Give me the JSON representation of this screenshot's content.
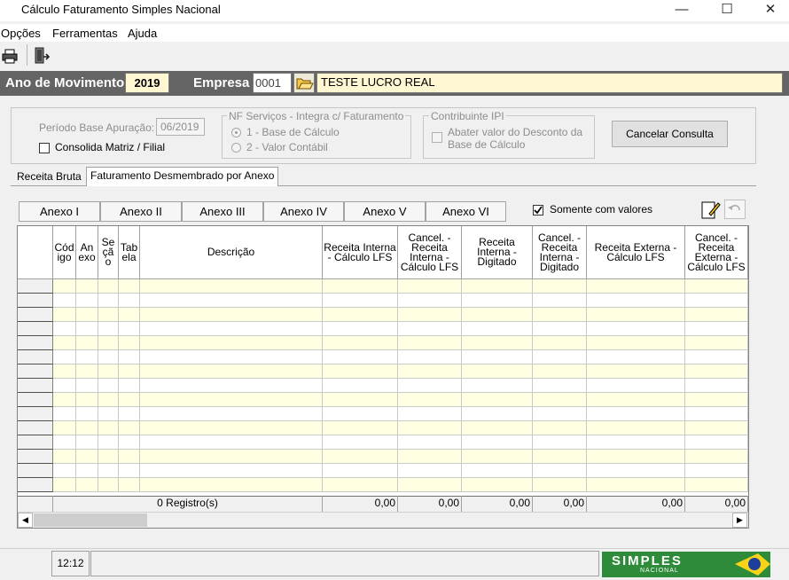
{
  "window": {
    "title": "Cálculo Faturamento Simples Nacional"
  },
  "menu": {
    "items": [
      "Opções",
      "Ferramentas",
      "Ajuda"
    ]
  },
  "header": {
    "ano_label": "Ano de Movimento",
    "ano_value": "2019",
    "empresa_label": "Empresa",
    "empresa_code": "0001",
    "empresa_name": "TESTE LUCRO REAL"
  },
  "filters": {
    "periodo_label": "Período Base Apuração:",
    "periodo_value": "06/2019",
    "consolida_label": "Consolida Matriz / Filial",
    "nf_group_title": "NF Serviços - Integra c/ Faturamento",
    "nf_option1": "1 -  Base de Cálculo",
    "nf_option2": "2 -  Valor Contábil",
    "ipi_group_title": "Contribuinte IPI",
    "ipi_line1": "Abater valor do Desconto da",
    "ipi_line2": "Base de Cálculo",
    "cancel_button": "Cancelar Consulta"
  },
  "tabs": [
    "Receita Bruta",
    "Faturamento Desmembrado por Anexo"
  ],
  "annex_tabs": [
    "Anexo I",
    "Anexo II",
    "Anexo III",
    "Anexo IV",
    "Anexo V",
    "Anexo VI"
  ],
  "somente_label": "Somente com valores",
  "somente_checked": true,
  "grid": {
    "headers": [
      "Cód igo",
      "An exo",
      "Se çã o",
      "Tab ela",
      "Descrição",
      "Receita Interna - Cálculo LFS",
      "Cancel. - Receita Interna - Cálculo LFS",
      "Receita Interna - Digitado",
      "Cancel. - Receita Interna - Digitado",
      "Receita Externa - Cálculo LFS",
      "Cancel. - Receita Externa - Cálculo LFS"
    ],
    "footer": {
      "registros": "0 Registro(s)",
      "totals": [
        "0,00",
        "0,00",
        "0,00",
        "0,00",
        "0,00",
        "0,00"
      ]
    }
  },
  "status": {
    "time": "12:12",
    "logo_text": "SIMPLES",
    "logo_sub": "NACIONAL"
  },
  "colors": {
    "band": "#646464",
    "highlight": "#fff6d2",
    "row_alt": "#ffffe1"
  }
}
